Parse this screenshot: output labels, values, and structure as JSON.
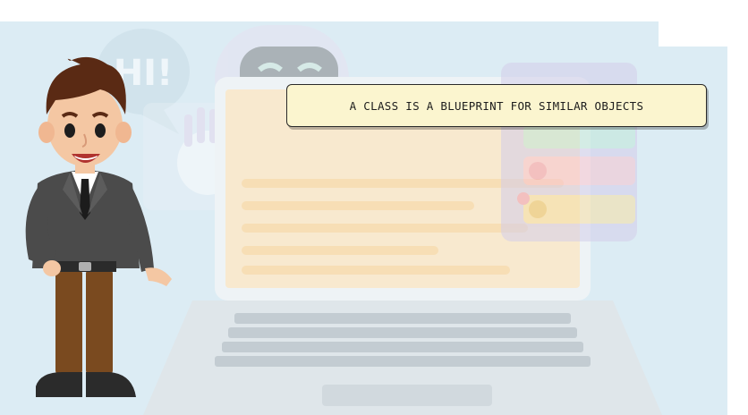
{
  "scene": {
    "caption": "A CLASS IS A BLUEPRINT FOR SIMILAR OBJECTS",
    "speech_bubble_text": "HI!",
    "colors": {
      "background": "#dcecf4",
      "caption_fill": "#fbf5cf",
      "caption_border": "#2a2a2a",
      "jacket": "#4b4b4b",
      "trousers": "#7a4a1f",
      "hair": "#5a2a14",
      "skin": "#f4c7a3",
      "laptop_screen": "#fbe6c2",
      "laptop_body": "#dfe6ea",
      "card_green": "#bfe7d8",
      "card_pink": "#f7c3cf",
      "card_yellow": "#f6dfa3"
    }
  }
}
